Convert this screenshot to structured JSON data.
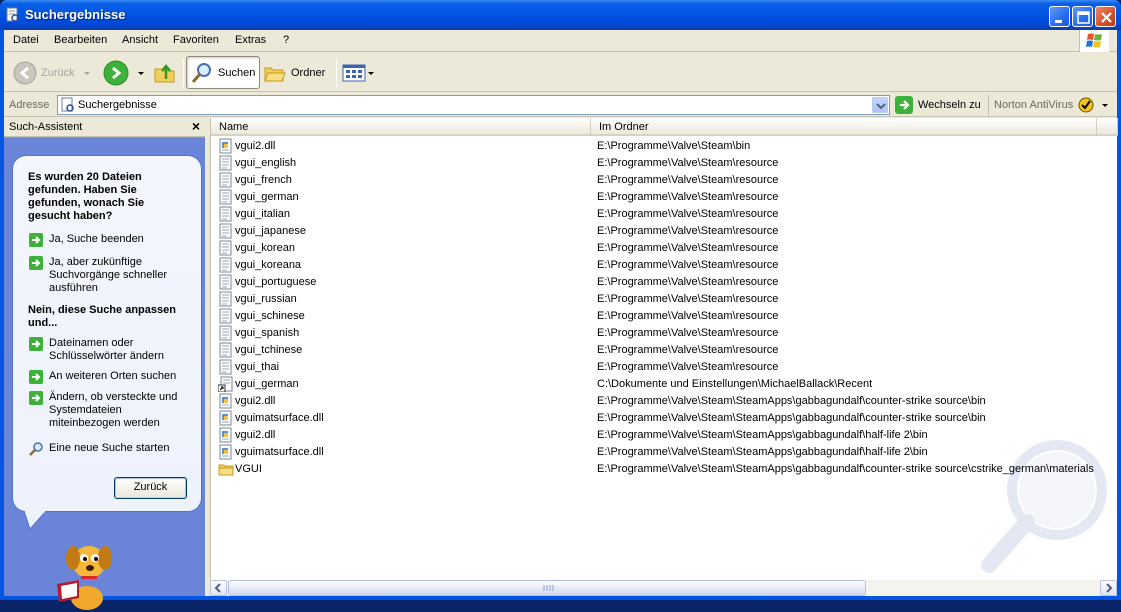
{
  "window": {
    "title": "Suchergebnisse"
  },
  "menu": [
    {
      "label": "Datei"
    },
    {
      "label": "Bearbeiten"
    },
    {
      "label": "Ansicht"
    },
    {
      "label": "Favoriten"
    },
    {
      "label": "Extras"
    },
    {
      "label": "?"
    }
  ],
  "toolbar": {
    "back_label": "Zurück",
    "search_label": "Suchen",
    "folders_label": "Ordner"
  },
  "address": {
    "label": "Adresse",
    "value": "Suchergebnisse",
    "go_label": "Wechseln zu",
    "norton_label": "Norton AntiVirus"
  },
  "assistant": {
    "header": "Such-Assistent",
    "close": "×",
    "question": "Es wurden 20 Dateien gefunden. Haben Sie gefunden, wonach Sie gesucht haben?",
    "yes_stop": "Ja, Suche beenden",
    "yes_faster": "Ja, aber zukünftige Suchvorgänge schneller ausführen",
    "refine_title": "Nein, diese Suche anpassen und...",
    "change_names": "Dateinamen oder Schlüsselwörter ändern",
    "other_places": "An weiteren Orten suchen",
    "hidden_files": "Ändern, ob versteckte und Systemdateien miteinbezogen werden",
    "new_search": "Eine neue Suche starten",
    "back_button": "Zurück"
  },
  "columns": {
    "name": "Name",
    "folder": "Im Ordner"
  },
  "files": [
    {
      "name": "vgui2.dll",
      "folder": "E:\\Programme\\Valve\\Steam\\bin",
      "icon": "dll-icon"
    },
    {
      "name": "vgui_english",
      "folder": "E:\\Programme\\Valve\\Steam\\resource",
      "icon": "text-file-icon"
    },
    {
      "name": "vgui_french",
      "folder": "E:\\Programme\\Valve\\Steam\\resource",
      "icon": "text-file-icon"
    },
    {
      "name": "vgui_german",
      "folder": "E:\\Programme\\Valve\\Steam\\resource",
      "icon": "text-file-icon"
    },
    {
      "name": "vgui_italian",
      "folder": "E:\\Programme\\Valve\\Steam\\resource",
      "icon": "text-file-icon"
    },
    {
      "name": "vgui_japanese",
      "folder": "E:\\Programme\\Valve\\Steam\\resource",
      "icon": "text-file-icon"
    },
    {
      "name": "vgui_korean",
      "folder": "E:\\Programme\\Valve\\Steam\\resource",
      "icon": "text-file-icon"
    },
    {
      "name": "vgui_koreana",
      "folder": "E:\\Programme\\Valve\\Steam\\resource",
      "icon": "text-file-icon"
    },
    {
      "name": "vgui_portuguese",
      "folder": "E:\\Programme\\Valve\\Steam\\resource",
      "icon": "text-file-icon"
    },
    {
      "name": "vgui_russian",
      "folder": "E:\\Programme\\Valve\\Steam\\resource",
      "icon": "text-file-icon"
    },
    {
      "name": "vgui_schinese",
      "folder": "E:\\Programme\\Valve\\Steam\\resource",
      "icon": "text-file-icon"
    },
    {
      "name": "vgui_spanish",
      "folder": "E:\\Programme\\Valve\\Steam\\resource",
      "icon": "text-file-icon"
    },
    {
      "name": "vgui_tchinese",
      "folder": "E:\\Programme\\Valve\\Steam\\resource",
      "icon": "text-file-icon"
    },
    {
      "name": "vgui_thai",
      "folder": "E:\\Programme\\Valve\\Steam\\resource",
      "icon": "text-file-icon"
    },
    {
      "name": "vgui_german",
      "folder": "C:\\Dokumente und Einstellungen\\MichaelBallack\\Recent",
      "icon": "shortcut-icon"
    },
    {
      "name": "vgui2.dll",
      "folder": "E:\\Programme\\Valve\\Steam\\SteamApps\\gabbagundalf\\counter-strike source\\bin",
      "icon": "dll-icon"
    },
    {
      "name": "vguimatsurface.dll",
      "folder": "E:\\Programme\\Valve\\Steam\\SteamApps\\gabbagundalf\\counter-strike source\\bin",
      "icon": "dll-icon"
    },
    {
      "name": "vgui2.dll",
      "folder": "E:\\Programme\\Valve\\Steam\\SteamApps\\gabbagundalf\\half-life 2\\bin",
      "icon": "dll-icon"
    },
    {
      "name": "vguimatsurface.dll",
      "folder": "E:\\Programme\\Valve\\Steam\\SteamApps\\gabbagundalf\\half-life 2\\bin",
      "icon": "dll-icon"
    },
    {
      "name": "VGUI",
      "folder": "E:\\Programme\\Valve\\Steam\\SteamApps\\gabbagundalf\\counter-strike source\\cstrike_german\\materials",
      "icon": "folder-icon"
    }
  ]
}
